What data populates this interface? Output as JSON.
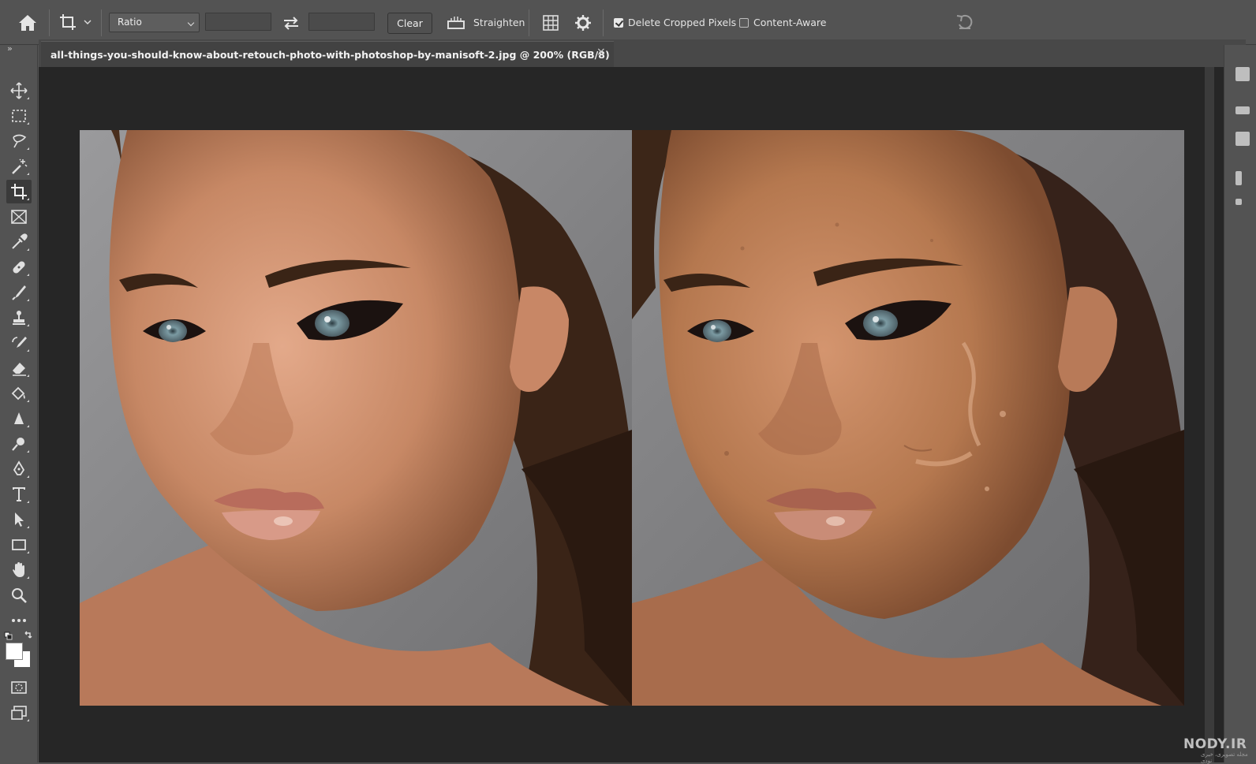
{
  "options_bar": {
    "ratio_value": "Ratio",
    "width_value": "",
    "height_value": "",
    "clear_label": "Clear",
    "straighten_label": "Straighten",
    "delete_cropped_label": "Delete Cropped Pixels",
    "delete_cropped_checked": true,
    "content_aware_label": "Content-Aware",
    "content_aware_checked": false
  },
  "document_tab": {
    "title": "all-things-you-should-know-about-retouch-photo-with-photoshop-by-manisoft-2.jpg @ 200% (RGB/8)",
    "close_glyph": "×"
  },
  "tools": [
    {
      "name": "move-tool",
      "icon": "move-icon"
    },
    {
      "name": "marquee-tool",
      "icon": "rect-marquee-icon"
    },
    {
      "name": "lasso-tool",
      "icon": "lasso-icon"
    },
    {
      "name": "magic-wand-tool",
      "icon": "magic-wand-icon"
    },
    {
      "name": "crop-tool",
      "icon": "crop-icon",
      "active": true
    },
    {
      "name": "frame-tool",
      "icon": "frame-icon"
    },
    {
      "name": "eyedropper-tool",
      "icon": "eyedropper-icon"
    },
    {
      "name": "healing-brush-tool",
      "icon": "bandage-icon"
    },
    {
      "name": "brush-tool",
      "icon": "brush-icon"
    },
    {
      "name": "clone-stamp-tool",
      "icon": "stamp-icon"
    },
    {
      "name": "history-brush-tool",
      "icon": "history-brush-icon"
    },
    {
      "name": "eraser-tool",
      "icon": "eraser-icon"
    },
    {
      "name": "paint-bucket-tool",
      "icon": "bucket-icon"
    },
    {
      "name": "sharpen-tool",
      "icon": "sharpen-icon"
    },
    {
      "name": "dodge-tool",
      "icon": "dodge-icon"
    },
    {
      "name": "pen-tool",
      "icon": "pen-icon"
    },
    {
      "name": "type-tool",
      "icon": "type-icon"
    },
    {
      "name": "path-selection-tool",
      "icon": "arrow-icon"
    },
    {
      "name": "rectangle-tool",
      "icon": "rectangle-icon"
    },
    {
      "name": "hand-tool",
      "icon": "hand-icon"
    },
    {
      "name": "zoom-tool",
      "icon": "zoom-icon"
    },
    {
      "name": "edit-toolbar",
      "icon": "more-icon"
    }
  ],
  "colors": {
    "foreground": "#ffffff",
    "background": "#ffffff",
    "canvas_bg": "#262626",
    "ui_bg": "#535353"
  },
  "canvas": {
    "images": [
      {
        "name": "retouched-portrait",
        "description_icon": "portrait-image"
      },
      {
        "name": "original-portrait",
        "description_icon": "portrait-image"
      }
    ]
  },
  "watermark": {
    "text": "NODY.IR",
    "subtext": "مجله تصویری، خبری نودی"
  }
}
